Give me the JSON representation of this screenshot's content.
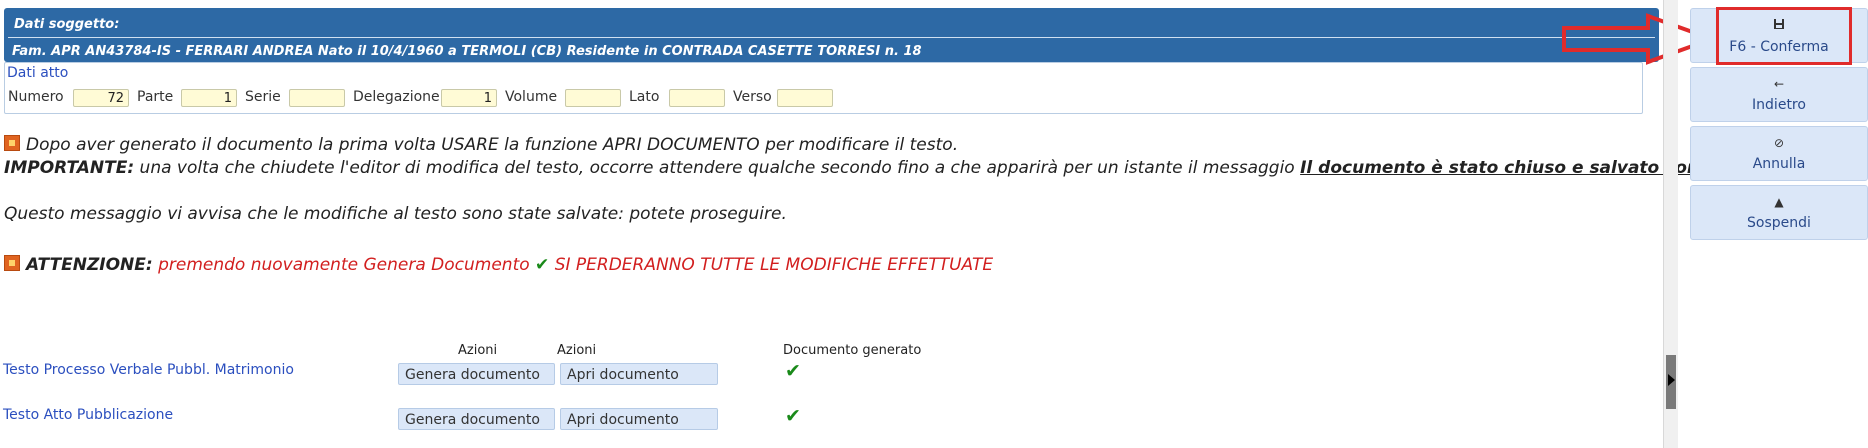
{
  "subject": {
    "title": "Dati soggetto:",
    "description": "Fam. APR AN43784-IS - FERRARI ANDREA Nato il 10/4/1960 a TERMOLI (CB) Residente in CONTRADA CASETTE TORRESI n. 18"
  },
  "atto": {
    "title": "Dati atto",
    "fields": {
      "numero": {
        "label": "Numero",
        "value": "72"
      },
      "parte": {
        "label": "Parte",
        "value": "1"
      },
      "serie": {
        "label": "Serie",
        "value": ""
      },
      "delegazione": {
        "label": "Delegazione",
        "value": "1"
      },
      "volume": {
        "label": "Volume",
        "value": ""
      },
      "lato": {
        "label": "Lato",
        "value": ""
      },
      "verso": {
        "label": "Verso",
        "value": ""
      }
    }
  },
  "messages": {
    "line1": "Dopo aver generato il documento la prima volta USARE la funzione APRI DOCUMENTO per modificare il testo.",
    "important_label": "IMPORTANTE:",
    "important_text": " una volta che chiudete l'editor di modifica del testo, occorre attendere qualche secondo fino a che apparirà per un istante il messaggio ",
    "important_emph": "Il documento è stato chiuso e salvato correttamente.",
    "saved_msg": "Questo messaggio vi avvisa che le modifiche al testo sono state salvate: potete proseguire.",
    "attention_label": "ATTENZIONE:",
    "attention_text": " premendo nuovamente Genera Documento ",
    "attention_warning": " SI PERDERANNO TUTTE LE MODIFICHE EFFETTUATE"
  },
  "table": {
    "headers": [
      "Azioni",
      "Azioni",
      "Documento generato"
    ],
    "rows": [
      {
        "label": "Testo Processo Verbale Pubbl. Matrimonio",
        "generate": "Genera documento",
        "open": "Apri documento",
        "generated": "✔"
      },
      {
        "label": "Testo Atto Pubblicazione",
        "generate": "Genera documento",
        "open": "Apri documento",
        "generated": "✔"
      }
    ]
  },
  "sidebar": {
    "confirm": {
      "icon": "save-icon",
      "label": "F6 - Conferma"
    },
    "back": {
      "icon": "arrow-left-icon",
      "label": "Indietro"
    },
    "cancel": {
      "icon": "cancel-icon",
      "label": "Annulla"
    },
    "suspend": {
      "icon": "warning-icon",
      "label": "Sospendi"
    }
  },
  "colors": {
    "header_blue": "#2d69a5",
    "input_yellow": "#fffbd6",
    "button_blue": "#dbe7f8",
    "link_blue": "#2b4fbf",
    "warning_red": "#d21f1f",
    "check_green": "#1a8a1a",
    "annotation_red": "#e02b2b"
  }
}
